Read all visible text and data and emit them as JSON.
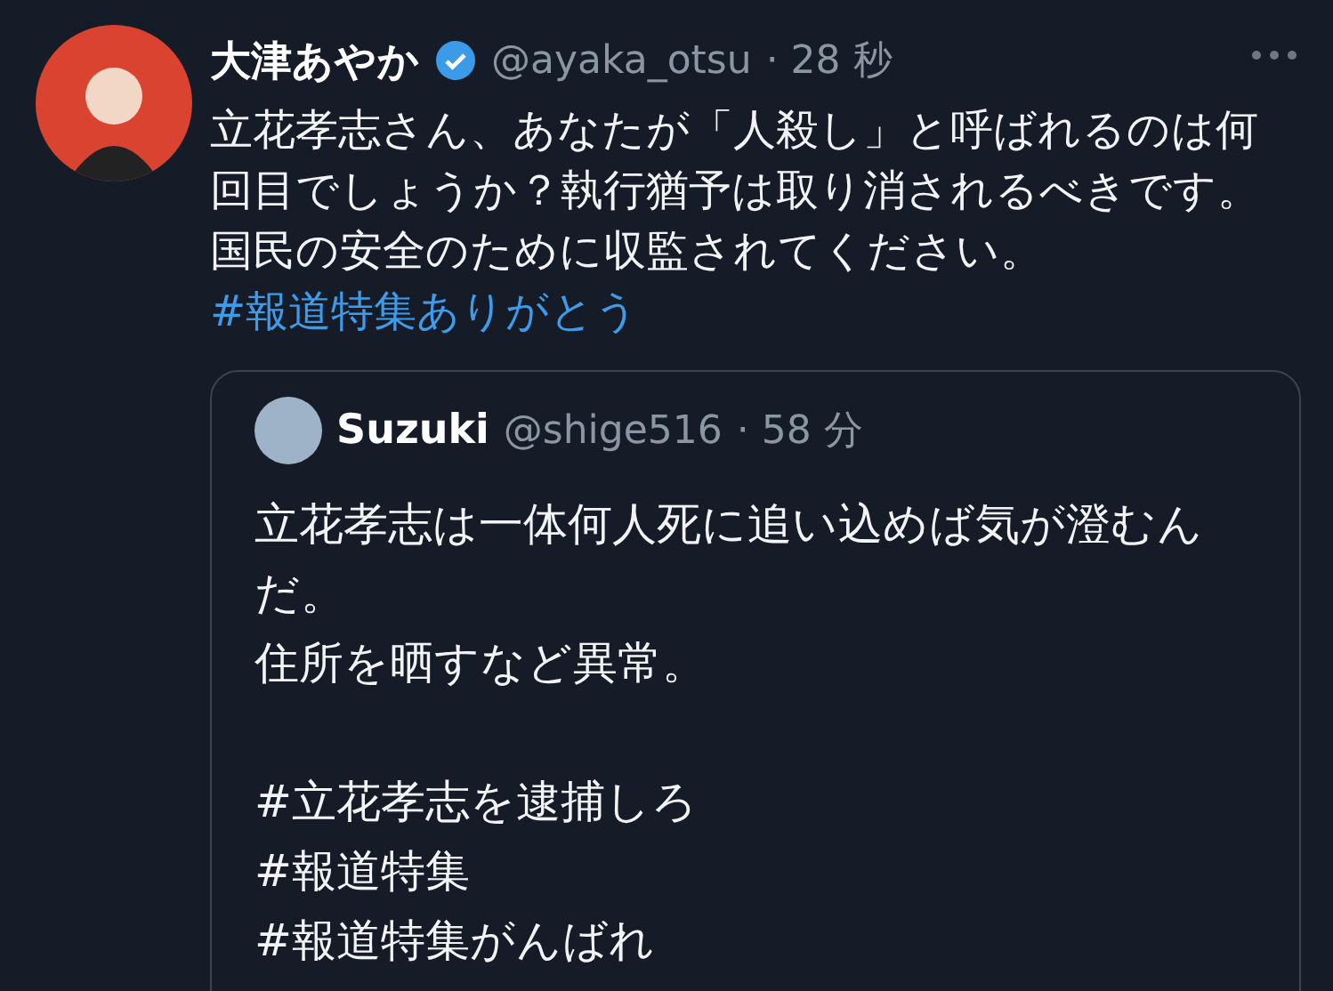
{
  "tweet": {
    "name": "大津あやか",
    "verified": true,
    "handle": "@ayaka_otsu",
    "time": "· 28 秒",
    "text": "立花孝志さん、あなたが「人殺し」と呼ばれるのは何回目でしょうか？執行猶予は取り消されるべきです。国民の安全のために収監されてください。",
    "hashtag": "#報道特集ありがとう"
  },
  "quote": {
    "name": "Suzuki",
    "handle": "@shige516",
    "time": "· 58 分",
    "paragraphs": [
      "立花孝志は一体何人死に追い込めば気が澄むんだ。",
      "住所を晒すなど異常。"
    ],
    "hashtags": [
      "#立花孝志を逮捕しろ",
      "#報道特集",
      "#報道特集がんばれ"
    ]
  }
}
